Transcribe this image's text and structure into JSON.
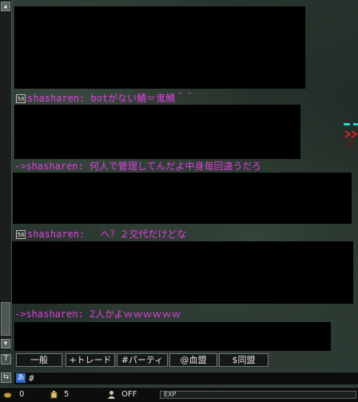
{
  "chat": {
    "messages": [
      {
        "badge": "50",
        "text": "shasharen: botがない鯖＝鬼鯖＾＾"
      },
      {
        "badge": "",
        "text": "->shasharen: 何人で管理してんだよ中身毎回違うだろ"
      },
      {
        "badge": "50",
        "text": "shasharen:　 へ？２交代だけどな"
      },
      {
        "badge": "",
        "text": "->shasharen: 2人かよｗｗｗｗｗｗ"
      }
    ],
    "colors": {
      "message": "#e040e0",
      "redacted": "#000000"
    }
  },
  "tabs": [
    "一般",
    "+トレード",
    "#パーティ",
    "@血盟",
    "$同盟"
  ],
  "input": {
    "ime_label": "あ",
    "text": "#"
  },
  "side_icons": {
    "text_icon": "T",
    "speech_icon": "⇆"
  },
  "scrollbar": {
    "up_icon": "▲",
    "down_icon": "▼"
  },
  "status": {
    "gold": "0",
    "items": "5",
    "pk": "OFF",
    "exp_label": "EXP"
  }
}
